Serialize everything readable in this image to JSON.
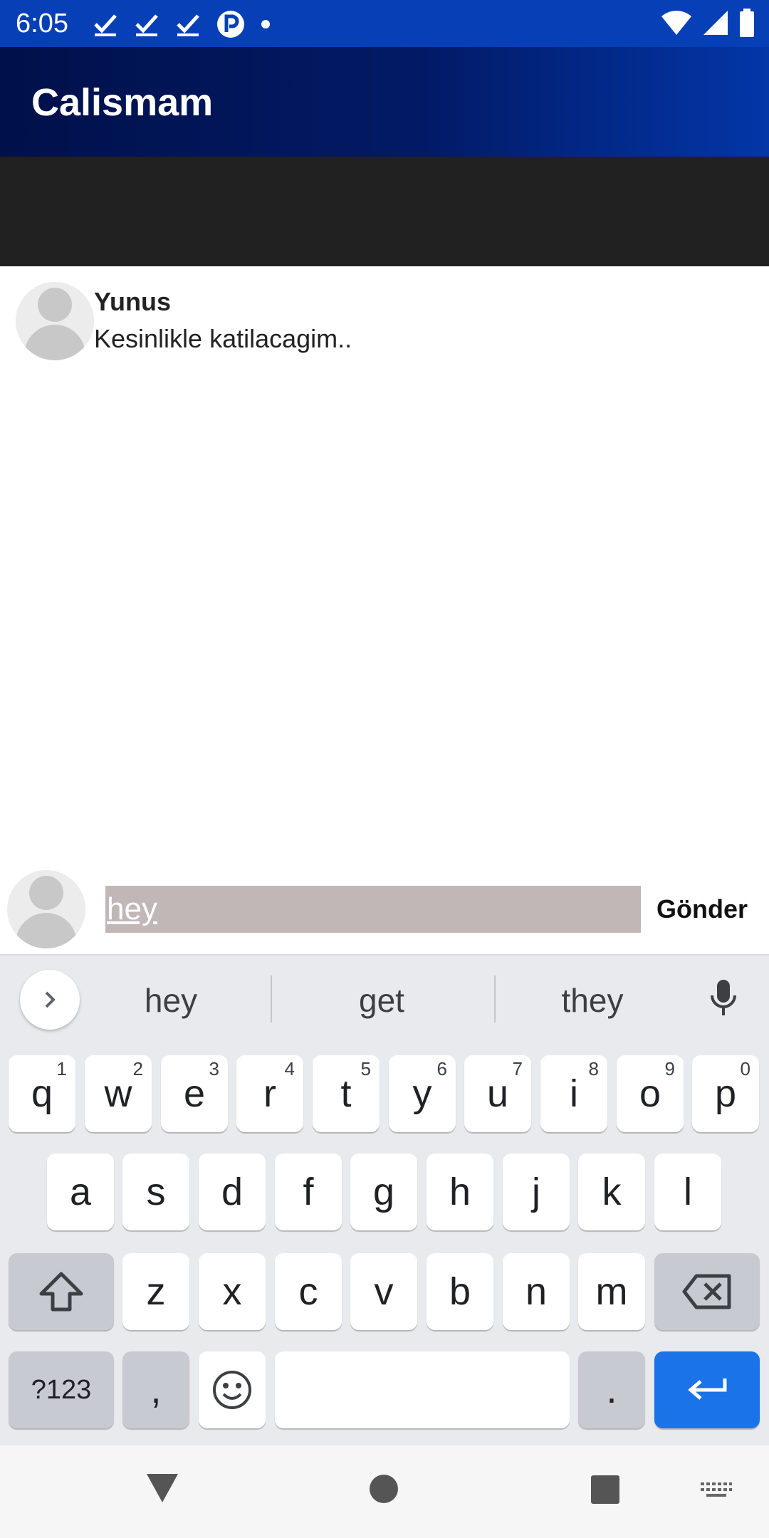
{
  "status_bar": {
    "time": "6:05",
    "left_icons": [
      "check-icon",
      "check-icon",
      "check-icon",
      "app-notification-icon",
      "dot-icon"
    ],
    "right_icons": [
      "wifi-icon",
      "signal-icon",
      "battery-icon"
    ]
  },
  "app_bar": {
    "title": "Calismam"
  },
  "messages": [
    {
      "author": "Yunus",
      "text": "Kesinlikle katilacagim.."
    }
  ],
  "composer": {
    "input_value": "hey",
    "send_label": "Gönder"
  },
  "keyboard": {
    "suggestions": [
      "hey",
      "get",
      "they"
    ],
    "row1": [
      {
        "key": "q",
        "hint": "1"
      },
      {
        "key": "w",
        "hint": "2"
      },
      {
        "key": "e",
        "hint": "3"
      },
      {
        "key": "r",
        "hint": "4"
      },
      {
        "key": "t",
        "hint": "5"
      },
      {
        "key": "y",
        "hint": "6"
      },
      {
        "key": "u",
        "hint": "7"
      },
      {
        "key": "i",
        "hint": "8"
      },
      {
        "key": "o",
        "hint": "9"
      },
      {
        "key": "p",
        "hint": "0"
      }
    ],
    "row2": [
      "a",
      "s",
      "d",
      "f",
      "g",
      "h",
      "j",
      "k",
      "l"
    ],
    "row3": [
      "z",
      "x",
      "c",
      "v",
      "b",
      "n",
      "m"
    ],
    "symbols_label": "?123",
    "comma_label": ",",
    "period_label": "."
  },
  "colors": {
    "status_bar": "#0740b6",
    "app_bar": "#021a66",
    "dark_strip": "#212121",
    "input_bg": "#c1b7b7",
    "enter_key": "#1a73e8"
  }
}
